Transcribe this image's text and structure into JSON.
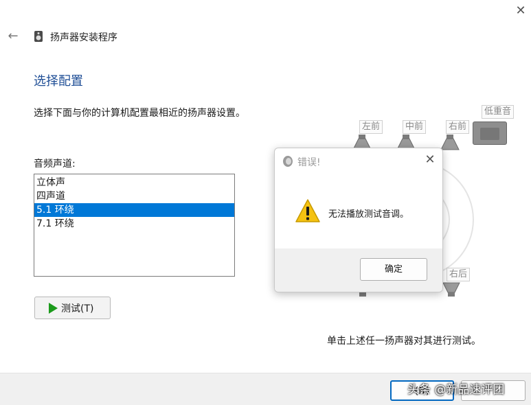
{
  "window": {
    "title": "扬声器安装程序",
    "close_glyph": "✕",
    "back_glyph": "←"
  },
  "main": {
    "heading": "选择配置",
    "description": "选择下面与你的计算机配置最相近的扬声器设置。",
    "channel_label": "音频声道:",
    "channels": [
      {
        "label": "立体声",
        "selected": false
      },
      {
        "label": "四声道",
        "selected": false
      },
      {
        "label": "5.1 环绕",
        "selected": true
      },
      {
        "label": "7.1 环绕",
        "selected": false
      }
    ],
    "test_button_label": "测试(T)",
    "speaker_hint": "单击上述任一扬声器对其进行测试。"
  },
  "speakers": {
    "front_left": "左前",
    "front_center": "中前",
    "front_right": "右前",
    "subwoofer": "低重音",
    "rear_right": "右后"
  },
  "footer": {
    "button_partial": "(N)"
  },
  "error_dialog": {
    "title": "错误!",
    "close_glyph": "✕",
    "message": "无法播放测试音调。",
    "ok_label": "确定"
  },
  "watermark": "头条 @新品速评团",
  "colors": {
    "accent": "#0078d7",
    "heading": "#1f4e96",
    "play_green": "#1b9a1b",
    "warning_yellow": "#f5c211"
  }
}
